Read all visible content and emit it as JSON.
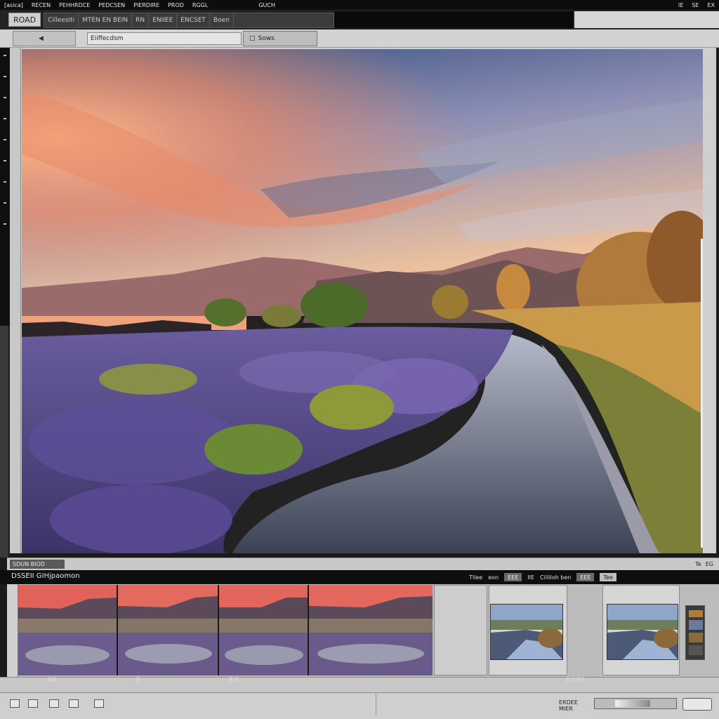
{
  "menu": {
    "items": [
      "[asica]",
      "RECEN",
      "PEHHRDCE",
      "PEDCSEN",
      "PIERDIRE",
      "PROD",
      "RGGL",
      "GUCH"
    ],
    "right": [
      "IE",
      "SE",
      "EX"
    ]
  },
  "tabs": {
    "active": "ROAD",
    "strip": [
      "Cilleesiti",
      "MTEN EN BEIN",
      "RN",
      "ENIIEE",
      "ENCSET",
      "Boen"
    ]
  },
  "toolbar": {
    "field": "Eiiffecdsm",
    "button": "Sows"
  },
  "status": {
    "left": "SDUN BIOD",
    "right": [
      "Te",
      "EG"
    ]
  },
  "filmstrip": {
    "title": "DSSEII GIHjpaomon",
    "controls": [
      "Tllee",
      "eon",
      "EEE",
      "IIE",
      "Cilliloh ben",
      "EEE",
      "Tee"
    ]
  },
  "lower": {
    "labels": [
      "NE",
      "E",
      "BIS",
      "EIDEE"
    ]
  },
  "bottom": {
    "zoom_label_1": "ERDEE",
    "zoom_label_2": "MIER"
  },
  "colors": {
    "sky_top": "#3f5a86",
    "sunset": "#f2845c",
    "lavender": "#6e5aa8",
    "river": "#8f99ad"
  }
}
